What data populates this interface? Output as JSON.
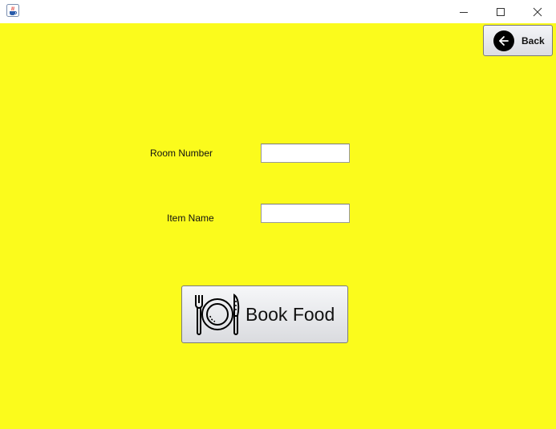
{
  "window": {
    "title": "",
    "app_icon": "java-cup-icon",
    "controls": {
      "minimize_icon": "minimize-icon",
      "maximize_icon": "maximize-icon",
      "close_icon": "close-icon"
    }
  },
  "colors": {
    "background": "#fbfb1c",
    "titlebar": "#ffffff",
    "button_face": "#e6e7eb"
  },
  "toolbar": {
    "back_label": "Back",
    "back_icon": "arrow-left-circle-icon"
  },
  "form": {
    "room_number_label": "Room Number",
    "room_number_value": "",
    "item_name_label": "Item Name",
    "item_name_value": ""
  },
  "actions": {
    "book_food_label": "Book Food",
    "book_food_icon": "plate-fork-knife-icon"
  }
}
